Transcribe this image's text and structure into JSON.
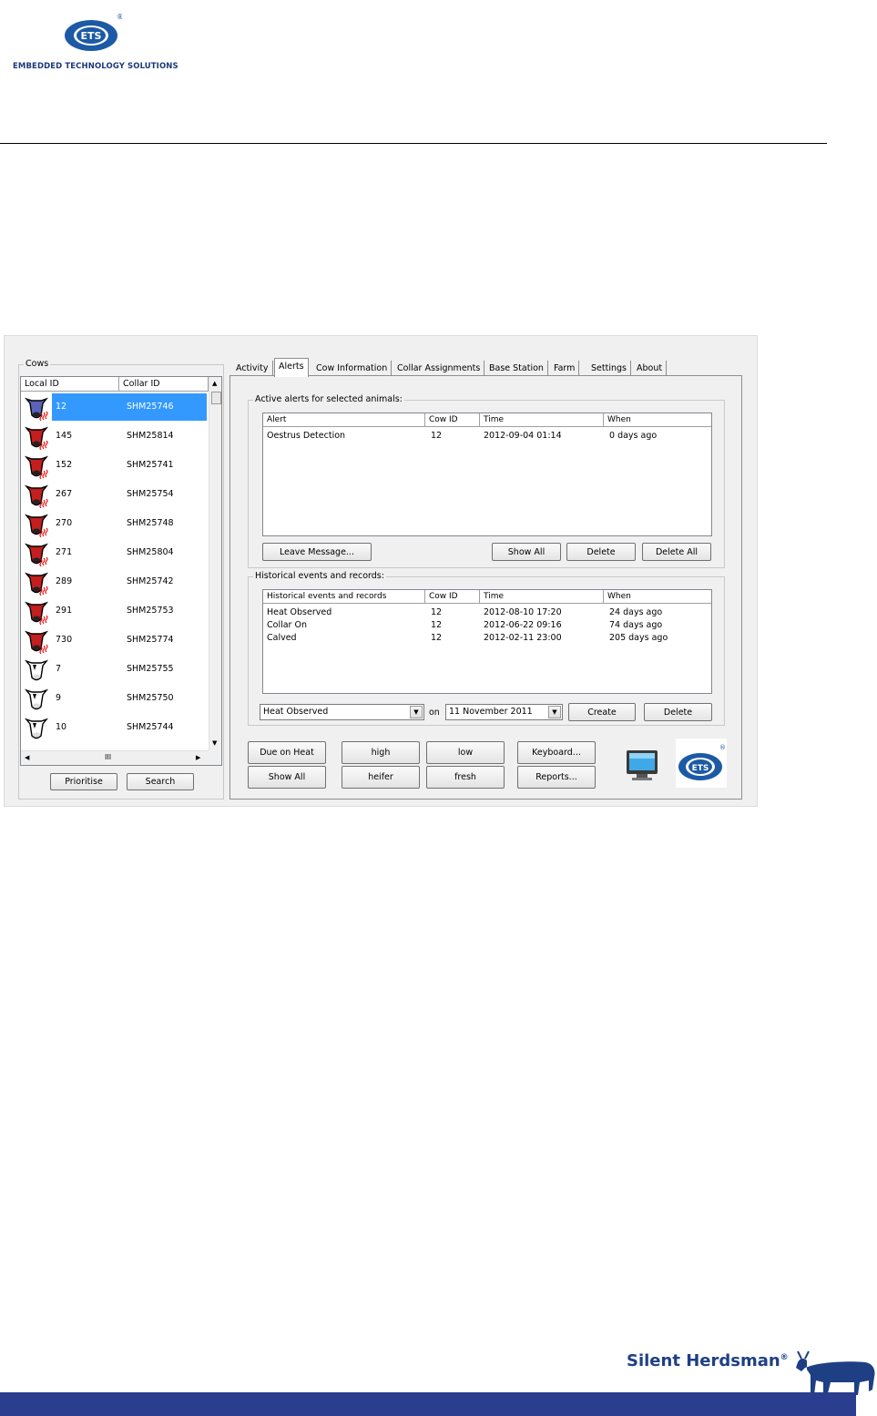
{
  "doc": {
    "logo_text": "ETS",
    "logo_reg": "®",
    "logo_caption": "EMBEDDED TECHNOLOGY SOLUTIONS",
    "footer_brand": "Silent Herdsman",
    "footer_reg": "®"
  },
  "cows": {
    "group_title": "Cows",
    "columns": [
      "Local ID",
      "Collar ID"
    ],
    "rows": [
      {
        "id": "12",
        "collar": "SHM25746",
        "icon": "blue-cow-heat-icon"
      },
      {
        "id": "145",
        "collar": "SHM25814",
        "icon": "red-cow-heat-icon"
      },
      {
        "id": "152",
        "collar": "SHM25741",
        "icon": "red-cow-heat-icon"
      },
      {
        "id": "267",
        "collar": "SHM25754",
        "icon": "red-cow-heat-icon"
      },
      {
        "id": "270",
        "collar": "SHM25748",
        "icon": "red-cow-heat-icon"
      },
      {
        "id": "271",
        "collar": "SHM25804",
        "icon": "red-cow-heat-icon"
      },
      {
        "id": "289",
        "collar": "SHM25742",
        "icon": "red-cow-heat-icon"
      },
      {
        "id": "291",
        "collar": "SHM25753",
        "icon": "red-cow-heat-icon"
      },
      {
        "id": "730",
        "collar": "SHM25774",
        "icon": "red-cow-heat-icon"
      },
      {
        "id": "7",
        "collar": "SHM25755",
        "icon": "white-cow-icon"
      },
      {
        "id": "9",
        "collar": "SHM25750",
        "icon": "white-cow-icon"
      },
      {
        "id": "10",
        "collar": "SHM25744",
        "icon": "white-cow-icon"
      }
    ],
    "scroll_grip": "III",
    "prioritise_label": "Prioritise",
    "search_label": "Search"
  },
  "tabs": [
    "Activity",
    "Alerts",
    "Cow Information",
    "Collar Assignments",
    "Base Station",
    "Farm",
    "Settings",
    "About"
  ],
  "active_tab": "Alerts",
  "alerts": {
    "title": "Active alerts for selected animals:",
    "columns": [
      "Alert",
      "Cow ID",
      "Time",
      "When"
    ],
    "rows": [
      [
        "Oestrus Detection",
        "12",
        "2012-09-04 01:14",
        "0 days ago"
      ]
    ],
    "leave_message": "Leave Message...",
    "show_all": "Show All",
    "delete": "Delete",
    "delete_all": "Delete All"
  },
  "history": {
    "title": "Historical events and records:",
    "columns": [
      "Historical events and records",
      "Cow ID",
      "Time",
      "When"
    ],
    "rows": [
      [
        "Heat Observed",
        "12",
        "2012-08-10 17:20",
        "24 days ago"
      ],
      [
        "Collar On",
        "12",
        "2012-06-22 09:16",
        "74 days ago"
      ],
      [
        "Calved",
        "12",
        "2012-02-11 23:00",
        "205 days ago"
      ]
    ],
    "event_type": "Heat Observed",
    "on_label": "on",
    "date": "11 November  2011",
    "create": "Create",
    "delete": "Delete"
  },
  "filters": {
    "due_on_heat": "Due on Heat",
    "show_all": "Show All",
    "high": "high",
    "heifer": "heifer",
    "low": "low",
    "fresh": "fresh",
    "keyboard": "Keyboard...",
    "reports": "Reports..."
  },
  "colors": {
    "selection": "#3399ff",
    "ets_blue": "#1c5aa6",
    "footer_bar": "#2a3d8f",
    "cow_red": "#c41e1e"
  }
}
